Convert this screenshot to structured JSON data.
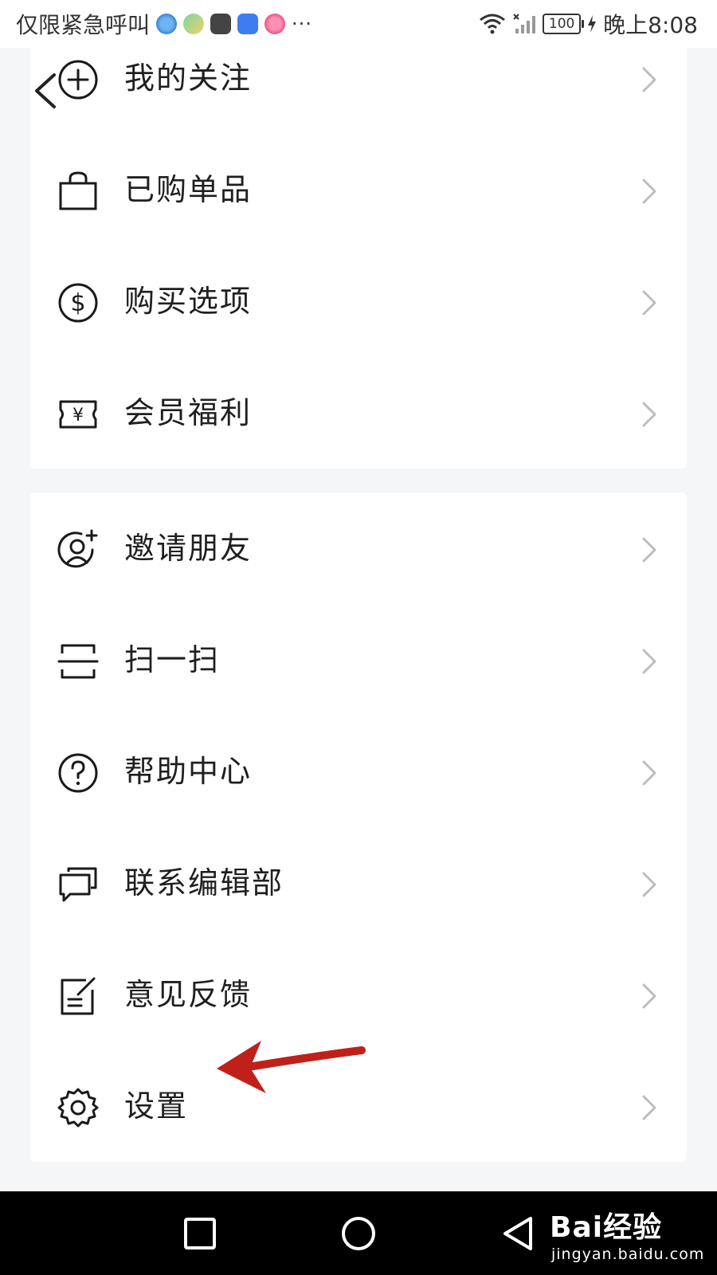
{
  "status_bar": {
    "carrier_text": "仅限紧急呼叫",
    "notification_icons": [
      "browser-icon",
      "app-icon",
      "huawei-appgallery-icon",
      "bulb-icon",
      "paint-icon"
    ],
    "more_indicator": "···",
    "battery_level": "100",
    "time": "晚上8:08"
  },
  "menu_group_1": [
    {
      "label": "我的关注",
      "icon": "plus-circle-icon"
    },
    {
      "label": "已购单品",
      "icon": "shopping-bag-icon"
    },
    {
      "label": "购买选项",
      "icon": "dollar-circle-icon"
    },
    {
      "label": "会员福利",
      "icon": "yuan-ticket-icon"
    }
  ],
  "menu_group_2": [
    {
      "label": "邀请朋友",
      "icon": "add-friend-icon"
    },
    {
      "label": "扫一扫",
      "icon": "scan-icon"
    },
    {
      "label": "帮助中心",
      "icon": "question-circle-icon"
    },
    {
      "label": "联系编辑部",
      "icon": "chat-bubbles-icon"
    },
    {
      "label": "意见反馈",
      "icon": "feedback-edit-icon"
    },
    {
      "label": "设置",
      "icon": "gear-icon"
    }
  ],
  "annotation": {
    "color": "#c0201a"
  },
  "watermark": {
    "brand": "Bai经验",
    "url": "jingyan.baidu.com"
  },
  "colors": {
    "background": "#f5f6f8",
    "card": "#ffffff",
    "text": "#1f1f1f",
    "chevron": "#bdbdbd"
  }
}
